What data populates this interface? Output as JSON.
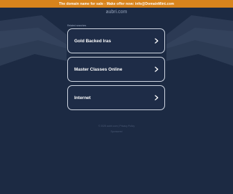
{
  "banner": {
    "text": "The domain name for sale - Make offer now: info@DomainMint.com"
  },
  "header": {
    "domain": "aubri.com"
  },
  "section": {
    "label": "Related searches"
  },
  "links": [
    {
      "label": "Gold Backed Iras"
    },
    {
      "label": "Master Classes Online"
    },
    {
      "label": "Internet"
    }
  ],
  "footer": {
    "line1": "© 2025 aubri.com  |  Privacy Policy",
    "line2": "Sponsored"
  },
  "icons": {
    "chevron": "chevron-right-icon"
  },
  "colors": {
    "background": "#1c2a43",
    "banner": "#d8841c",
    "card_border": "#d4dbe6"
  }
}
